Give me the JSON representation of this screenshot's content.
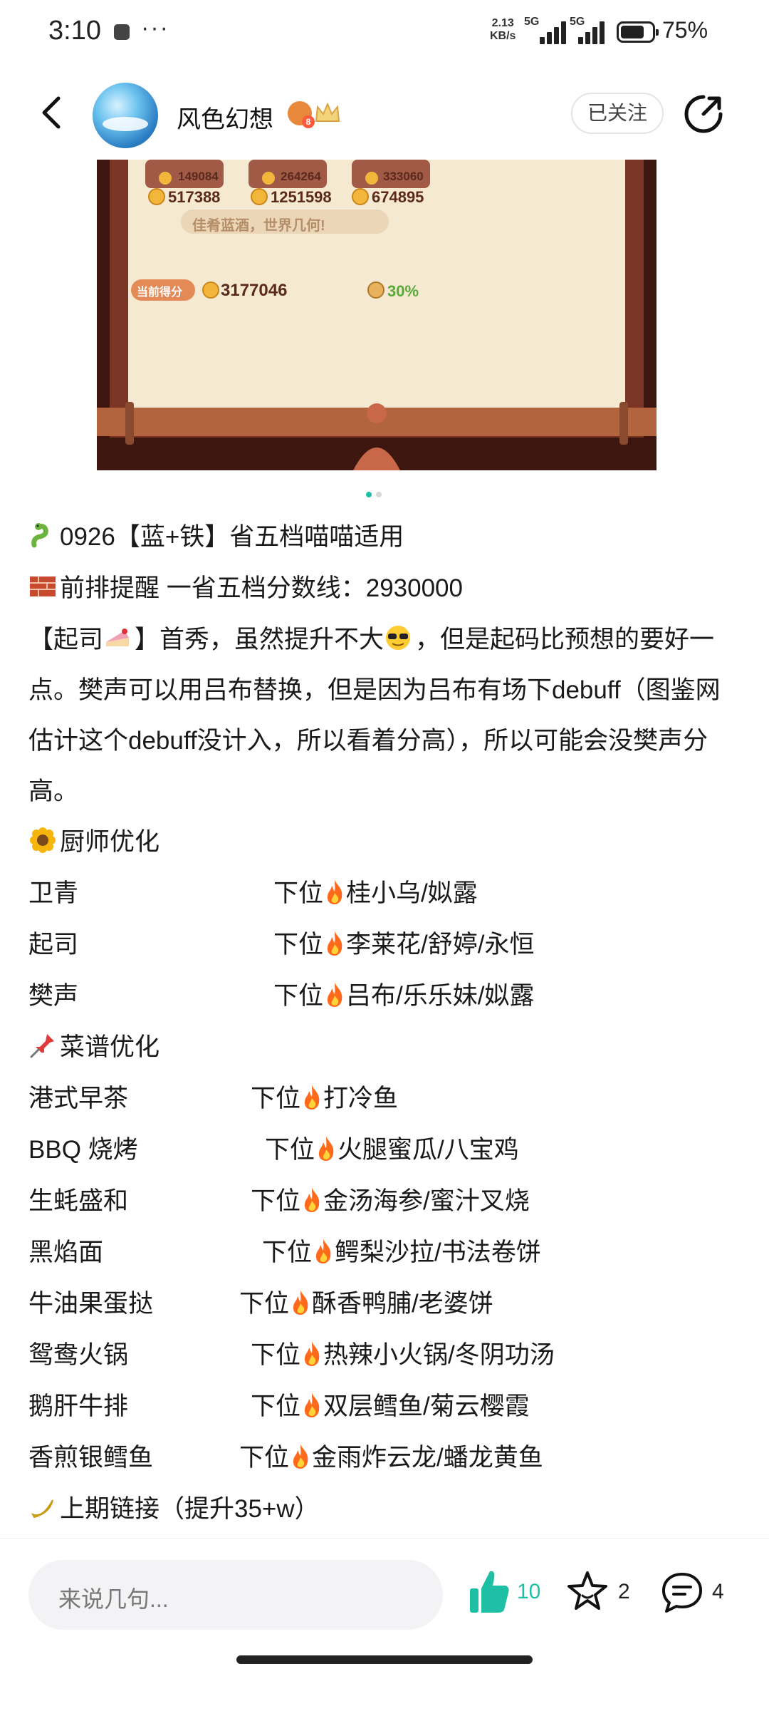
{
  "status_bar": {
    "time": "3:10",
    "speed_value": "2.13",
    "speed_unit": "KB/s",
    "network1": "5G",
    "network2": "5G",
    "battery": "75%",
    "battery_level": 0.75
  },
  "header": {
    "author": "风色幻想",
    "level_badge": "8",
    "follow_label": "已关注"
  },
  "game_image": {
    "dish_count_1": "149084",
    "dish_count_2": "264264",
    "dish_count_3": "333060",
    "dish_score_1": "517388",
    "dish_score_2": "1251598",
    "dish_score_3": "674895",
    "banner": "佳肴蓝酒，世界几何!",
    "current_score_label": "当前得分",
    "current_score": "3177046",
    "bonus": "30%"
  },
  "pager": {
    "count": 2,
    "active": 0
  },
  "post": {
    "title": "0926【蓝+铁】省五档喵喵适用",
    "reminder": "前排提醒 一省五档分数线：2930000",
    "paragraph_a": "【起司",
    "paragraph_b": "】首秀，虽然提升不大",
    "paragraph_c": "，但是起码比预想的要好一点。樊声可以用吕布替换，但是因为吕布有场下debuff（图鉴网估计这个debuff没计入，所以看着分高），所以可能会没樊声分高。",
    "chef_section": "厨师优化",
    "chefs": [
      {
        "name": "卫青",
        "label": "下位",
        "options": "桂小乌/姒露"
      },
      {
        "name": "起司",
        "label": "下位",
        "options": "李莱花/舒婷/永恒"
      },
      {
        "name": "樊声",
        "label": "下位",
        "options": "吕布/乐乐妹/姒露"
      }
    ],
    "recipe_section": "菜谱优化",
    "recipes": [
      {
        "name": "港式早茶",
        "label": "下位",
        "options": "打冷鱼"
      },
      {
        "name": "BBQ 烧烤",
        "label": "下位",
        "options": "火腿蜜瓜/八宝鸡"
      },
      {
        "name": "生蚝盛和",
        "label": "下位",
        "options": "金汤海参/蜜汁叉烧"
      },
      {
        "name": "黑焰面",
        "label": "下位",
        "options": "鳄梨沙拉/书法卷饼"
      },
      {
        "name": "牛油果蛋挞",
        "label": "下位",
        "options": "酥香鸭脯/老婆饼"
      },
      {
        "name": "鸳鸯火锅",
        "label": "下位",
        "options": "热辣小火锅/冬阴功汤"
      },
      {
        "name": "鹅肝牛排",
        "label": "下位",
        "options": "双层鳕鱼/菊云樱霞"
      },
      {
        "name": "香煎银鳕鱼",
        "label": "下位",
        "options": "金雨炸云龙/蟠龙黄鱼"
      }
    ],
    "last_link": "上期链接（提升35+w）"
  },
  "bottom_bar": {
    "comment_placeholder": "来说几句...",
    "like_count": "10",
    "favorite_count": "2",
    "comment_count": "4"
  },
  "colors": {
    "like_accent": "#1fbfa5",
    "fire": "#ff6a1a",
    "gold_coin": "#f2b63a",
    "bonus_green": "#5aa83a",
    "frame_wood": "#6b2d1f",
    "parchment": "#f6e9d2"
  },
  "icons": {
    "back": "chevron-left-icon",
    "share": "share-icon",
    "like": "thumbs-up-icon",
    "favorite": "star-icon",
    "comment": "chat-bubble-icon"
  }
}
